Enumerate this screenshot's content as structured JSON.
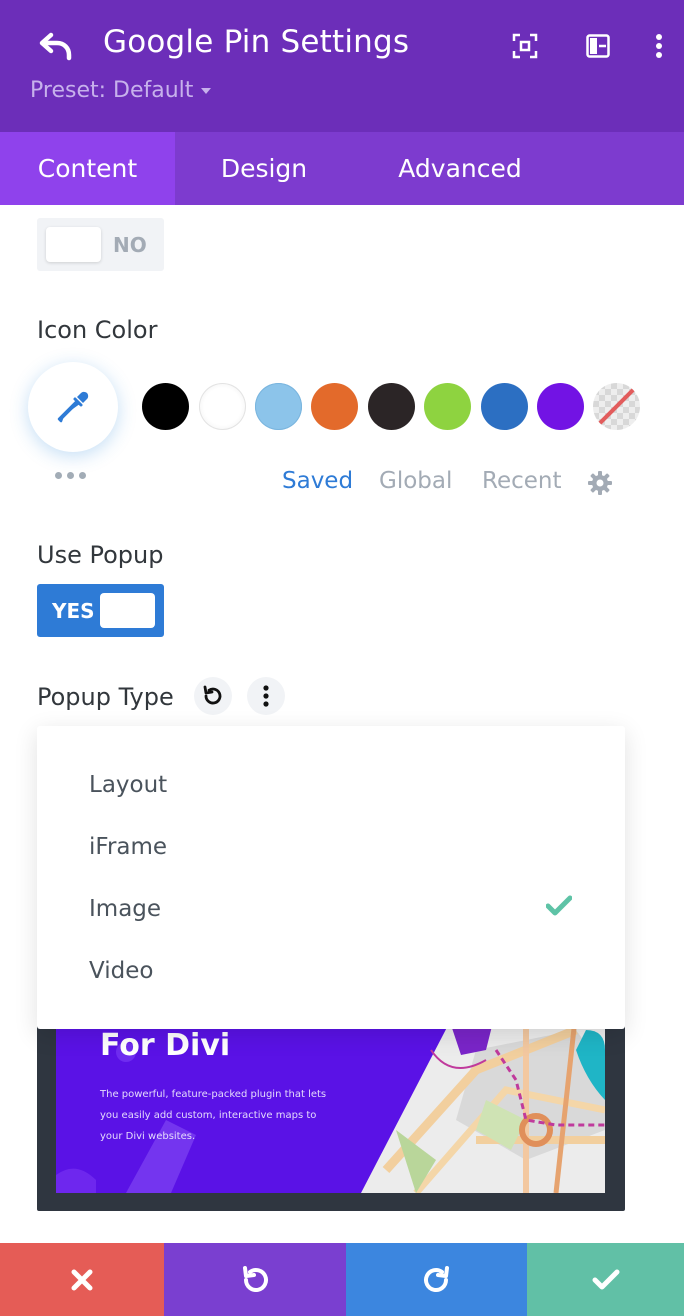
{
  "header": {
    "title": "Google Pin Settings",
    "preset_label": "Preset: Default",
    "background": "#6c2eb9"
  },
  "tabs": [
    {
      "label": "Content",
      "active": true
    },
    {
      "label": "Design",
      "active": false
    },
    {
      "label": "Advanced",
      "active": false
    }
  ],
  "fields": {
    "top_toggle": {
      "value": "NO"
    },
    "icon_color": {
      "label": "Icon Color",
      "swatches": [
        "#000000",
        "#ffffff",
        "#8cc4ea",
        "#e36a2b",
        "#2b2526",
        "#8ed340",
        "#2c6fc2",
        "#7213e4",
        "transparent"
      ],
      "tabs": [
        {
          "label": "Saved",
          "active": true
        },
        {
          "label": "Global",
          "active": false
        },
        {
          "label": "Recent",
          "active": false
        }
      ]
    },
    "use_popup": {
      "label": "Use Popup",
      "value": "YES"
    },
    "popup_type": {
      "label": "Popup Type",
      "options": [
        "Layout",
        "iFrame",
        "Image",
        "Video"
      ],
      "selected": "Image"
    }
  },
  "preview": {
    "title": "For Divi",
    "description": "The powerful, feature-packed plugin that lets you easily add custom, interactive maps to your Divi websites."
  },
  "colors": {
    "accent_blue": "#2e7bd6",
    "cancel": "#e55c56",
    "undo": "#7a3fd0",
    "redo": "#3c86df",
    "save": "#61c0a6",
    "check": "#5ec3a6"
  }
}
